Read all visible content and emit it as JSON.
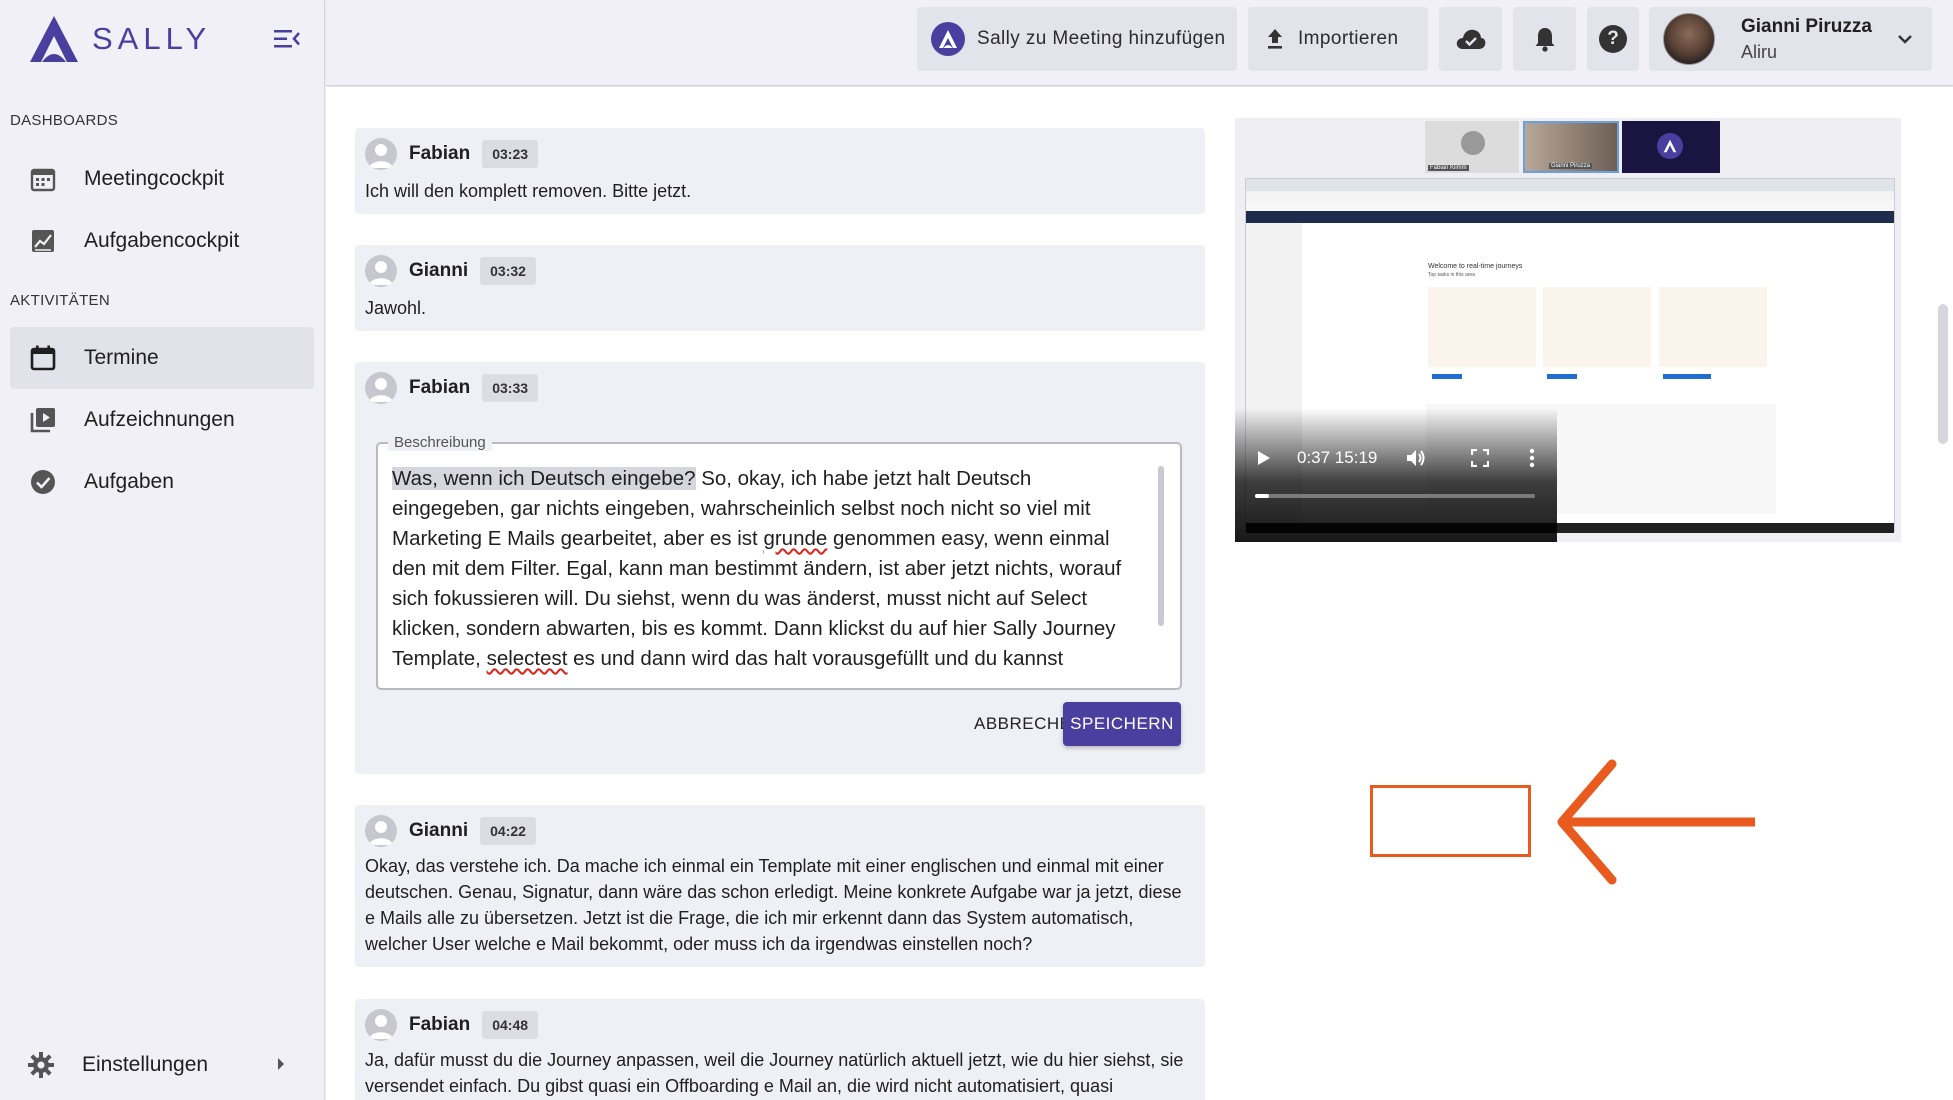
{
  "app": {
    "name": "SALLY"
  },
  "colors": {
    "brand": "#4a3f9e",
    "accent": "#e85a1e",
    "sidebar_bg": "#f0f0f6",
    "card_bg": "#efeff6"
  },
  "sidebar": {
    "section_dashboards": "DASHBOARDS",
    "section_activities": "AKTIVITÄTEN",
    "items": [
      {
        "label": "Meetingcockpit",
        "icon": "calendar-grid-icon"
      },
      {
        "label": "Aufgabencockpit",
        "icon": "chart-icon"
      },
      {
        "label": "Termine",
        "icon": "calendar-icon",
        "active": true
      },
      {
        "label": "Aufzeichnungen",
        "icon": "video-library-icon"
      },
      {
        "label": "Aufgaben",
        "icon": "check-circle-icon"
      }
    ],
    "settings_label": "Einstellungen"
  },
  "topbar": {
    "add_to_meeting": "Sally zu Meeting hinzufügen",
    "import": "Importieren",
    "user": {
      "name": "Gianni Piruzza",
      "org": "Aliru"
    }
  },
  "transcript": [
    {
      "speaker": "Fabian",
      "time": "03:23",
      "text": "Ich will den komplett removen. Bitte jetzt."
    },
    {
      "speaker": "Gianni",
      "time": "03:32",
      "text": "Jawohl."
    },
    {
      "speaker": "Fabian",
      "time": "03:33",
      "editing": true
    },
    {
      "speaker": "Gianni",
      "time": "04:22",
      "text": "Okay, das verstehe ich. Da mache ich einmal ein Template mit einer englischen und einmal mit einer deutschen. Genau, Signatur, dann wäre das schon erledigt. Meine konkrete Aufgabe war ja jetzt, diese e Mails alle zu übersetzen. Jetzt ist die Frage, die ich mir erkennt dann das System automatisch, welcher User welche e Mail bekommt, oder muss ich da irgendwas einstellen noch?"
    },
    {
      "speaker": "Fabian",
      "time": "04:48",
      "text": "Ja, dafür musst du die Journey anpassen, weil die Journey natürlich aktuell jetzt, wie du hier siehst, sie versendet einfach. Du gibst quasi ein Offboarding e Mail an, die wird nicht automatisiert, quasi"
    }
  ],
  "editor": {
    "legend": "Beschreibung",
    "highlighted": "Was, wenn ich Deutsch eingebe?",
    "line1_rest": " So, okay, ich habe jetzt halt Deutsch",
    "line2": "eingegeben, gar nichts eingeben, wahrscheinlich selbst noch nicht so viel mit",
    "line3_a": "Marketing E Mails gearbeitet, aber es ist ",
    "line3_err": "grunde",
    "line3_b": " genommen easy, wenn einmal",
    "line4": "den mit dem Filter. Egal, kann man bestimmt ändern, ist aber jetzt nichts, worauf",
    "line5": "sich fokussieren will. Du siehst, wenn du was änderst, musst nicht auf Select",
    "line6": "klicken, sondern abwarten, bis es kommt. Dann klickst du auf hier Sally Journey",
    "line7_a": "Template, ",
    "line7_err": "selectest",
    "line7_b": " es und dann wird das halt vorausgefüllt und du kannst",
    "cancel": "ABBRECHEN",
    "save": "SPEICHERN"
  },
  "video": {
    "time": "0:37 15:19",
    "progress": 0.05,
    "thumb_names": [
      "Fabian Klimm",
      "Gianni Piruzza"
    ],
    "screen_title": "Welcome to real-time journeys",
    "screen_sub": "Top tasks in this area"
  }
}
